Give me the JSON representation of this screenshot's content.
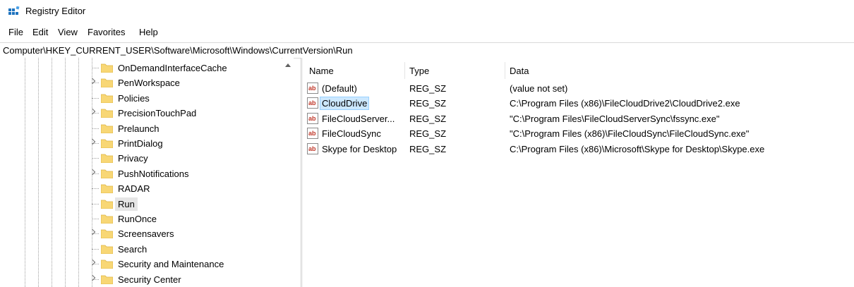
{
  "window": {
    "title": "Registry Editor"
  },
  "menu": [
    "File",
    "Edit",
    "View",
    "Favorites",
    "Help"
  ],
  "address": "Computer\\HKEY_CURRENT_USER\\Software\\Microsoft\\Windows\\CurrentVersion\\Run",
  "tree": {
    "selected_key": "Run",
    "items": [
      {
        "label": "OnDemandInterfaceCache",
        "expandable": false
      },
      {
        "label": "PenWorkspace",
        "expandable": true
      },
      {
        "label": "Policies",
        "expandable": false
      },
      {
        "label": "PrecisionTouchPad",
        "expandable": true
      },
      {
        "label": "Prelaunch",
        "expandable": false
      },
      {
        "label": "PrintDialog",
        "expandable": true
      },
      {
        "label": "Privacy",
        "expandable": false
      },
      {
        "label": "PushNotifications",
        "expandable": true
      },
      {
        "label": "RADAR",
        "expandable": false
      },
      {
        "label": "Run",
        "expandable": false
      },
      {
        "label": "RunOnce",
        "expandable": false
      },
      {
        "label": "Screensavers",
        "expandable": true
      },
      {
        "label": "Search",
        "expandable": false
      },
      {
        "label": "Security and Maintenance",
        "expandable": true
      },
      {
        "label": "Security Center",
        "expandable": true
      }
    ]
  },
  "values": {
    "columns": [
      "Name",
      "Type",
      "Data"
    ],
    "selected_name": "CloudDrive",
    "rows": [
      {
        "name": "(Default)",
        "type": "REG_SZ",
        "data": "(value not set)"
      },
      {
        "name": "CloudDrive",
        "type": "REG_SZ",
        "data": "C:\\Program Files (x86)\\FileCloudDrive2\\CloudDrive2.exe"
      },
      {
        "name": "FileCloudServer...",
        "type": "REG_SZ",
        "data": "\"C:\\Program Files\\FileCloudServerSync\\fssync.exe\""
      },
      {
        "name": "FileCloudSync",
        "type": "REG_SZ",
        "data": "\"C:\\Program Files (x86)\\FileCloudSync\\FileCloudSync.exe\""
      },
      {
        "name": "Skype for Desktop",
        "type": "REG_SZ",
        "data": "C:\\Program Files (x86)\\Microsoft\\Skype for Desktop\\Skype.exe"
      }
    ]
  },
  "icons": {
    "app": "registry-editor-icon",
    "folder": "folder-icon",
    "string_value": "string-value-icon",
    "expander": "chevron-right-icon",
    "scroll_up": "scroll-up-icon"
  },
  "colors": {
    "folder": "#f8d775",
    "selection_highlight": "#cce8ff",
    "tree_selection": "#e5e5e5",
    "app_icon_blue": "#1e73be"
  }
}
